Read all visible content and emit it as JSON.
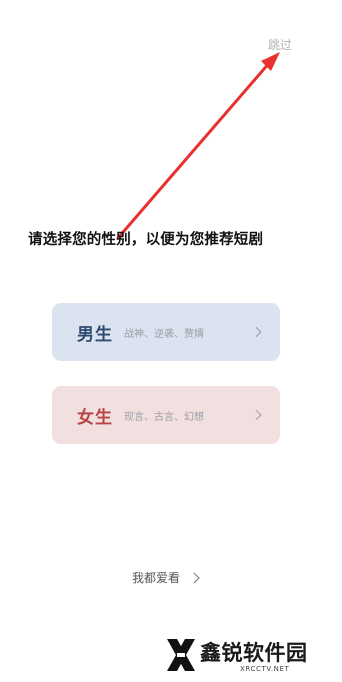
{
  "header": {
    "skip_label": "跳过"
  },
  "prompt": {
    "text": "请选择您的性别，以便为您推荐短剧"
  },
  "options": [
    {
      "title": "男生",
      "tags": "战神、逆袭、赘婿",
      "bg": "#dae3ef",
      "title_color": "#2f4a6f"
    },
    {
      "title": "女生",
      "tags": "现言、古言、幻想",
      "bg": "#f2dfe0",
      "title_color": "#b84444"
    }
  ],
  "footer": {
    "all_like_label": "我都爱看"
  },
  "watermark": {
    "brand": "鑫锐软件园",
    "site": "XRCCTV.NET"
  },
  "annotation": {
    "arrow_color": "#e8312f"
  }
}
